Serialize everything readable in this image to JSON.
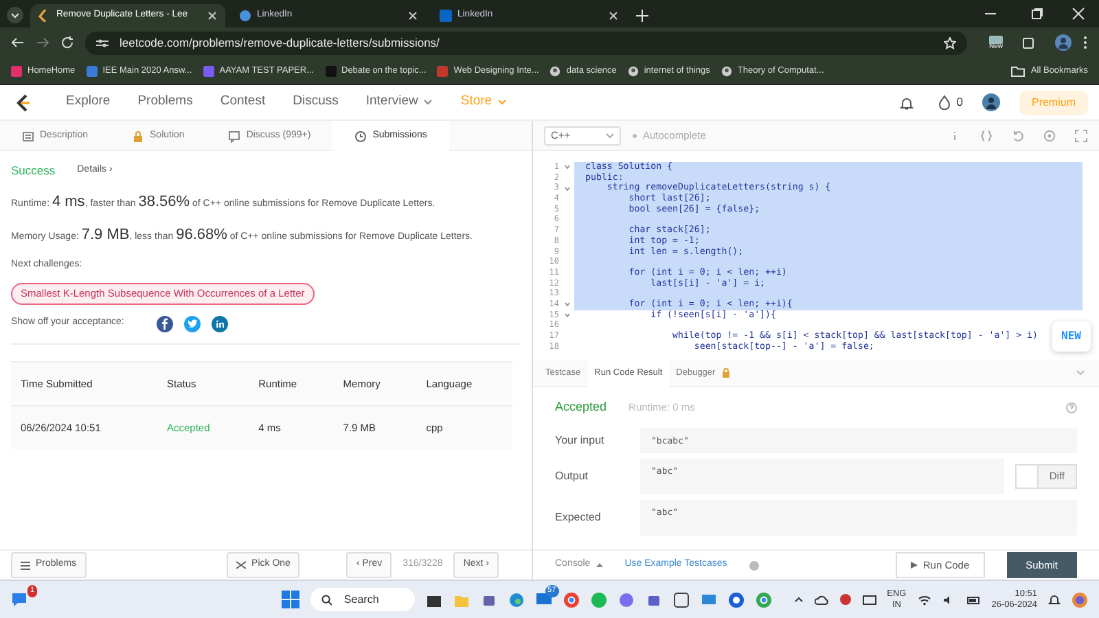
{
  "browser": {
    "tabs": [
      {
        "title": "Remove Duplicate Letters - Lee",
        "selected": true
      },
      {
        "title": "LinkedIn",
        "selected": false
      },
      {
        "title": "LinkedIn",
        "selected": false
      }
    ],
    "address": "leetcode.com/problems/remove-duplicate-letters/submissions/",
    "bookmarks": [
      "HomeHome",
      "IEE Main 2020 Answ...",
      "AAYAM TEST PAPER...",
      "Debate on the topic...",
      "Web Designing Inte...",
      "data science",
      "internet of things",
      "Theory of Computat..."
    ],
    "all_bookmarks": "All Bookmarks",
    "new_badge": "New"
  },
  "site_nav": {
    "items": [
      {
        "label": "Explore",
        "dropdown": false,
        "highlighted": false
      },
      {
        "label": "Problems",
        "dropdown": false,
        "highlighted": false
      },
      {
        "label": "Contest",
        "dropdown": false,
        "highlighted": false
      },
      {
        "label": "Discuss",
        "dropdown": false,
        "highlighted": false
      },
      {
        "label": "Interview",
        "dropdown": true,
        "highlighted": false
      },
      {
        "label": "Store",
        "dropdown": true,
        "highlighted": true
      }
    ],
    "streak": "0",
    "premium": "Premium"
  },
  "problem_tabs": [
    {
      "label": "Description",
      "selected": false
    },
    {
      "label": "Solution",
      "selected": false
    },
    {
      "label": "Discuss (999+)",
      "selected": false
    },
    {
      "label": "Submissions",
      "selected": true
    }
  ],
  "submission": {
    "status": "Success",
    "details": "Details ›",
    "runtime": "Runtime: **4 ms**, faster than **38.56%** of C++ online submissions for Remove Duplicate Letters.",
    "memory": "Memory Usage: **7.9 MB**, less than **96.68%** of C++ online submissions for Remove Duplicate Letters.",
    "next_label": "Next challenges:",
    "challenge": "Smallest K-Length Subsequence With Occurrences of a Letter",
    "share_label": "Show off your acceptance:"
  },
  "table": {
    "columns": [
      "Time Submitted",
      "Status",
      "Runtime",
      "Memory",
      "Language"
    ],
    "rows": [
      [
        "06/26/2024 10:51",
        "Accepted",
        "4 ms",
        "7.9 MB",
        "cpp"
      ]
    ]
  },
  "footer": {
    "problems": "Problems",
    "pick_one": "Pick One",
    "prev": "‹ Prev",
    "counter": "316/3228",
    "next": "Next ›"
  },
  "editor": {
    "language": "C++",
    "autocomplete": "Autocomplete",
    "lines": [
      {
        "num": "1",
        "fold": true,
        "selected": true,
        "text": "class Solution {"
      },
      {
        "num": "2",
        "fold": false,
        "selected": true,
        "text": "public:"
      },
      {
        "num": "3",
        "fold": true,
        "selected": true,
        "text": "    string removeDuplicateLetters(string s) {"
      },
      {
        "num": "4",
        "fold": false,
        "selected": true,
        "text": "        short last[26];"
      },
      {
        "num": "5",
        "fold": false,
        "selected": true,
        "text": "        bool seen[26] = {false};"
      },
      {
        "num": "6",
        "fold": false,
        "selected": true
      },
      {
        "num": "7",
        "fold": false,
        "selected": true,
        "text": "        char stack[26];"
      },
      {
        "num": "8",
        "fold": false,
        "selected": true,
        "text": "        int top = -1;"
      },
      {
        "num": "9",
        "fold": false,
        "selected": true,
        "text": "        int len = s.length();"
      },
      {
        "num": "10",
        "fold": false,
        "selected": true
      },
      {
        "num": "11",
        "fold": false,
        "selected": true,
        "text": "        for (int i = 0; i < len; ++i)"
      },
      {
        "num": "12",
        "fold": false,
        "selected": true,
        "text": "            last[s[i] - 'a'] = i;"
      },
      {
        "num": "13",
        "fold": false,
        "selected": true
      },
      {
        "num": "14",
        "fold": true,
        "selected": true,
        "text": "        for (int i = 0; i < len; ++i){"
      },
      {
        "num": "15",
        "fold": true,
        "selected": false,
        "text": "            if (!seen[s[i] - 'a']){"
      },
      {
        "num": "16",
        "fold": false,
        "selected": false
      },
      {
        "num": "17",
        "fold": false,
        "selected": false,
        "text": "                while(top != -1 && s[i] < stack[top] && last[stack[top] - 'a'] > i)"
      },
      {
        "num": "18",
        "fold": false,
        "selected": false,
        "text": "                    seen[stack[top--] - 'a'] = false;"
      }
    ],
    "new_button": "NEW"
  },
  "result_tabs": [
    {
      "label": "Testcase",
      "selected": false,
      "locked": false
    },
    {
      "label": "Run Code Result",
      "selected": true,
      "locked": false
    },
    {
      "label": "Debugger",
      "selected": false,
      "locked": true
    }
  ],
  "result": {
    "verdict": "Accepted",
    "runtime": "Runtime: 0 ms",
    "fields": [
      {
        "label": "Your input",
        "value": "\"bcabc\""
      },
      {
        "label": "Output",
        "value": "\"abc\""
      },
      {
        "label": "Expected",
        "value": "\"abc\""
      }
    ],
    "diff": {
      "label": "Diff",
      "on": false
    }
  },
  "console": {
    "console": "Console",
    "example": "Use Example Testcases",
    "run": "Run Code",
    "submit": "Submit"
  },
  "taskbar": {
    "chat_badge": "1",
    "search": "Search",
    "mail_badge": "57",
    "lang": "ENG",
    "region": "IN",
    "time": "10:51",
    "date": "26-06-2024"
  }
}
